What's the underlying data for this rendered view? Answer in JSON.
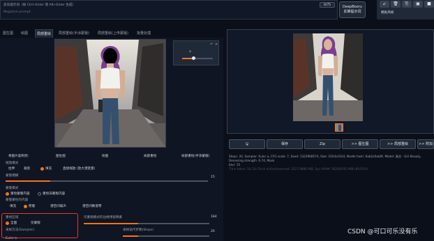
{
  "prompts": {
    "positive": "反向提示词（按 Ctrl+Enter 或 Alt+Enter 生成）",
    "negative": "Negative prompt",
    "counter": "0/75"
  },
  "deepbooru": {
    "line1": "DeepBooru",
    "line2": "反推提示词"
  },
  "right_tools": {
    "style_label": "模板风格",
    "icons": [
      "arrow-icon",
      "trash-icon",
      "copy-icon",
      "save-icon",
      "disk-icon"
    ]
  },
  "tabs": [
    "图生图",
    "绘图",
    "局部重绘",
    "局部重绘(手涂蒙版)",
    "局部重绘(上传蒙版)",
    "批量处理"
  ],
  "active_tab_index": 2,
  "resize_row": {
    "label": "将图片复制到:",
    "options": [
      "图生图",
      "绘图",
      "局部重绘",
      "局部重绘(手涂蒙版)"
    ]
  },
  "resize_mode": {
    "label": "缩放模式",
    "options": [
      "拉伸",
      "裁剪",
      "填充",
      "直接缩放 (放大潜变量)"
    ],
    "selected": 2
  },
  "mask_blur": {
    "label": "蒙版模糊",
    "value": "15",
    "fraction": 0.22
  },
  "mask_mode": {
    "label": "蒙版模式",
    "options": [
      "重绘蒙版内容",
      "重绘非蒙版内容"
    ],
    "selected": 0
  },
  "masked_content": {
    "label": "蒙版蒙住的内容",
    "options": [
      "填充",
      "原版",
      "潜空间噪声",
      "潜空间数值零"
    ],
    "selected": 1
  },
  "inpaint_area": {
    "label": "重绘区域",
    "options": [
      "全图",
      "仅蒙版"
    ],
    "selected": 0
  },
  "padding": {
    "label": "仅蒙版模式的边缘预留像素",
    "value": "184"
  },
  "sampling_method": {
    "label": "采样方法(Sampler)"
  },
  "sampling_steps": {
    "label": "采样迭代步数(Steps)",
    "value": "20"
  },
  "euler": "Euler a",
  "action_buttons": [
    "🖫",
    "保存",
    "Zip",
    ">> 图生图",
    ">> 局部重绘",
    ">> 附加"
  ],
  "info": {
    "line1": "Steps: 20, Sampler: Euler a, CFG scale: 7, Seed: 1322968574, Size: 1024x1024, Model hash: 6ab2a5ab0f, Model: 真实 · Girl Beauty, Denoising strength: 0.74, Mask",
    "line2": "blur: 15",
    "line3": "Time taken: 10.12s  Torch active/reserved: 3527/3886 MiB, Sys VRAM: 5624/8192 MiB (68.65%)"
  },
  "watermark": "CSDN @可口可乐没有乐",
  "colors": {
    "accent": "#f97316",
    "highlight_box": "#e53935",
    "background": "#0b0f19"
  }
}
